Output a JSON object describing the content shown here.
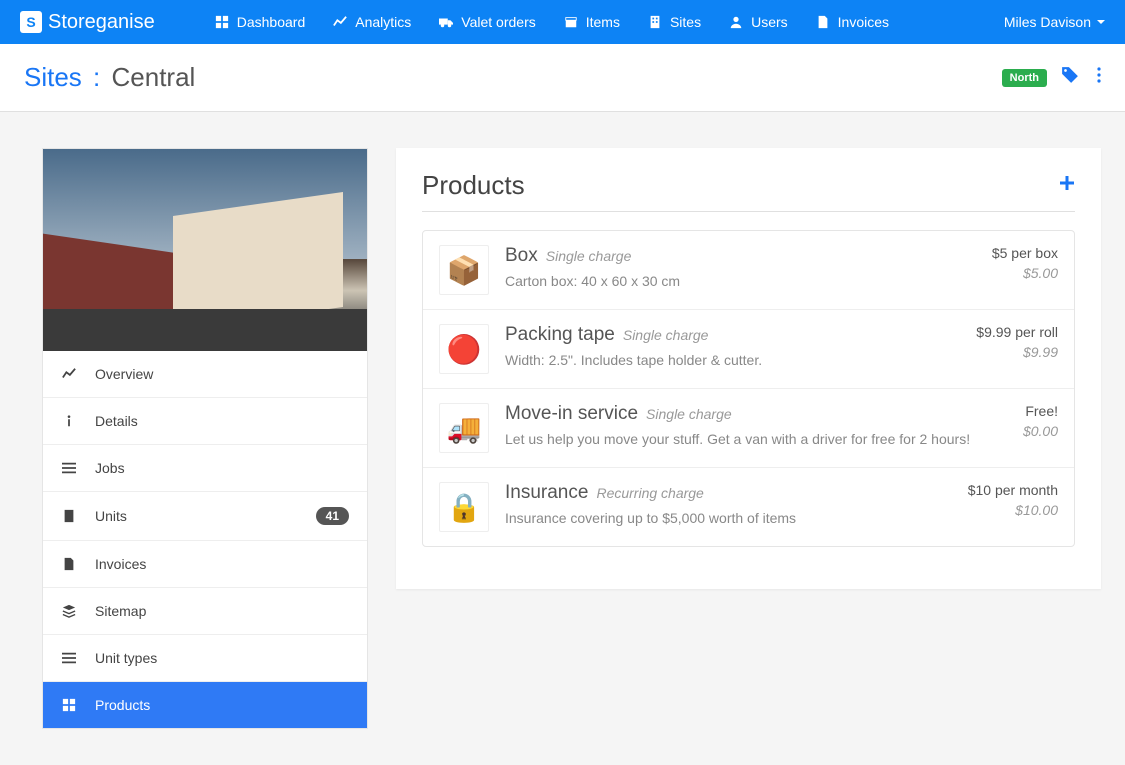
{
  "brand": "Storeganise",
  "nav": [
    {
      "label": "Dashboard",
      "icon": "dashboard"
    },
    {
      "label": "Analytics",
      "icon": "chart"
    },
    {
      "label": "Valet orders",
      "icon": "truck"
    },
    {
      "label": "Items",
      "icon": "box"
    },
    {
      "label": "Sites",
      "icon": "building"
    },
    {
      "label": "Users",
      "icon": "user"
    },
    {
      "label": "Invoices",
      "icon": "file"
    }
  ],
  "user": "Miles Davison",
  "breadcrumb": {
    "root": "Sites",
    "sep": ":",
    "current": "Central"
  },
  "region_badge": "North",
  "sidebar": {
    "items": [
      {
        "label": "Overview",
        "icon": "chart"
      },
      {
        "label": "Details",
        "icon": "info"
      },
      {
        "label": "Jobs",
        "icon": "list"
      },
      {
        "label": "Units",
        "icon": "building",
        "count": "41"
      },
      {
        "label": "Invoices",
        "icon": "file"
      },
      {
        "label": "Sitemap",
        "icon": "layers"
      },
      {
        "label": "Unit types",
        "icon": "list"
      },
      {
        "label": "Products",
        "icon": "grid",
        "active": true
      }
    ]
  },
  "panel": {
    "title": "Products"
  },
  "products": [
    {
      "name": "Box",
      "type": "Single charge",
      "desc": "Carton box: 40 x 60 x 30 cm",
      "price": "$5 per box",
      "amount": "$5.00",
      "emoji": "📦"
    },
    {
      "name": "Packing tape",
      "type": "Single charge",
      "desc": "Width: 2.5\". Includes tape holder & cutter.",
      "price": "$9.99 per roll",
      "amount": "$9.99",
      "emoji": "🔴"
    },
    {
      "name": "Move-in service",
      "type": "Single charge",
      "desc": "Let us help you move your stuff. Get a van with a driver for free for 2 hours!",
      "price": "Free!",
      "amount": "$0.00",
      "emoji": "🚚"
    },
    {
      "name": "Insurance",
      "type": "Recurring charge",
      "desc": "Insurance covering up to $5,000 worth of items",
      "price": "$10 per month",
      "amount": "$10.00",
      "emoji": "🔒"
    }
  ]
}
